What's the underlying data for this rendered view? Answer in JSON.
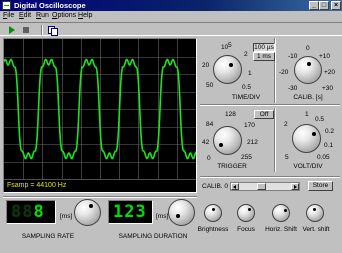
{
  "window": {
    "title": "Digital Oscilloscope",
    "min": "_",
    "max": "□",
    "close": "×"
  },
  "menu": [
    {
      "label": "File",
      "u": "F",
      "rest": "ile"
    },
    {
      "label": "Edit",
      "u": "E",
      "rest": "dit"
    },
    {
      "label": "Run",
      "u": "R",
      "rest": "un"
    },
    {
      "label": "Options",
      "u": "O",
      "rest": "ptions"
    },
    {
      "label": "Help",
      "u": "H",
      "rest": "elp"
    }
  ],
  "toolbar": {
    "icons": [
      "play-icon",
      "stop-icon",
      "copy-icon"
    ]
  },
  "screen": {
    "fsamp": "Fsamp = 44100 Hz",
    "trace_color": "#19e619",
    "grid_color": "#6a6a6a"
  },
  "time_div": {
    "label": "TIME/DIV",
    "ticks": [
      "10",
      "5",
      "2",
      "20",
      "1",
      "50",
      "0.5"
    ],
    "unit_pressed": "100 µs",
    "unit_other": "1 ms"
  },
  "calib": {
    "label": "CALIB. [s]",
    "ticks": [
      "0",
      "-10",
      "+10",
      "-20",
      "+20",
      "-30",
      "+30"
    ]
  },
  "trigger": {
    "label": "TRIGGER",
    "off": "Off",
    "ticks": [
      "128",
      "84",
      "170",
      "42",
      "212",
      "0",
      "255"
    ]
  },
  "volt_div": {
    "label": "VOLT/DIV",
    "ticks": [
      "1",
      "0.5",
      "2",
      "0.2",
      "5",
      "0.1",
      "0.05"
    ]
  },
  "calib_bar": {
    "label": "CALIB. 0 V",
    "store": "Store"
  },
  "sampling_rate": {
    "digits": "8",
    "dim": "88",
    "unit": "[ms]",
    "label": "SAMPLING RATE"
  },
  "sampling_duration": {
    "digits": "123",
    "unit": "[ms]",
    "label": "SAMPLING DURATION"
  },
  "small_knobs": [
    {
      "label": "Brightness"
    },
    {
      "label": "Focus"
    },
    {
      "label": "Horiz. Shift"
    },
    {
      "label": "Vert. shift"
    }
  ]
}
